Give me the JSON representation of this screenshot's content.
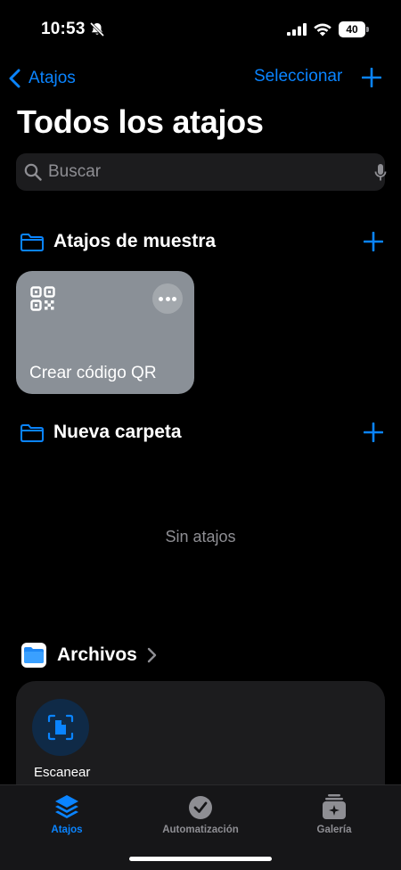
{
  "status_bar": {
    "time": "10:53",
    "battery": "40"
  },
  "nav": {
    "back_label": "Atajos",
    "select_label": "Seleccionar"
  },
  "title": "Todos los atajos",
  "search": {
    "placeholder": "Buscar",
    "value": ""
  },
  "folders": [
    {
      "name": "Atajos de muestra"
    },
    {
      "name": "Nueva carpeta"
    }
  ],
  "shortcut_card": {
    "label": "Crear código QR",
    "color": "#8a9097",
    "icon": "qr-code-icon"
  },
  "empty_state": "Sin atajos",
  "files": {
    "title": "Archivos",
    "action_label": "Escanear"
  },
  "tabs": [
    {
      "label": "Atajos",
      "icon": "layers-icon",
      "active": true
    },
    {
      "label": "Automatización",
      "icon": "clock-check-icon",
      "active": false
    },
    {
      "label": "Galería",
      "icon": "gallery-icon",
      "active": false
    }
  ],
  "colors": {
    "accent": "#0a84ff",
    "background": "#000000",
    "card": "#1c1c1e",
    "secondary_text": "#8e8e93"
  }
}
